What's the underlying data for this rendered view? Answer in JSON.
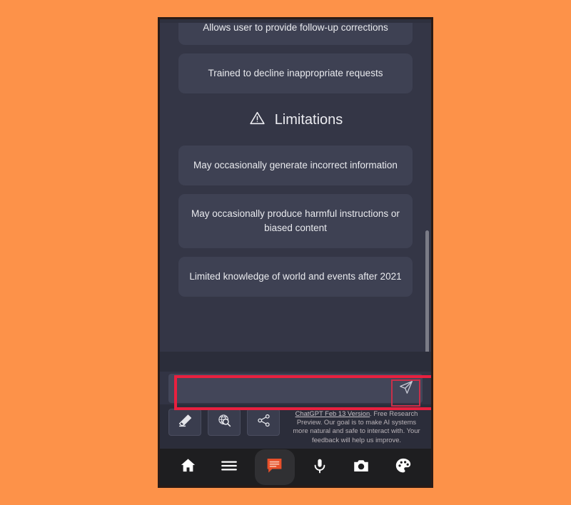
{
  "background_color": "#fd9249",
  "phone": {
    "frame_color": "#2a1b16",
    "screen_bg": "#343646"
  },
  "chat": {
    "cards_above": [
      {
        "text": "Allows user to provide follow-up corrections",
        "clipped": true
      },
      {
        "text": "Trained to decline inappropriate requests",
        "clipped": false
      }
    ],
    "section": {
      "title": "Limitations",
      "icon": "warning-triangle-icon"
    },
    "limitation_cards": [
      {
        "text": "May occasionally generate incorrect information"
      },
      {
        "text": "May occasionally produce harmful instructions or biased content"
      },
      {
        "text": "Limited knowledge of world and events after 2021"
      }
    ],
    "scrollbar_visible": true
  },
  "composer": {
    "input_value": "",
    "input_placeholder": "",
    "send_icon": "send-paper-plane-icon",
    "highlight_color": "#e8203f",
    "send_highlight_color": "#c8304a"
  },
  "tools": [
    {
      "name": "clear-conversation-button",
      "icon": "eraser-icon"
    },
    {
      "name": "web-search-button",
      "icon": "globe-search-icon"
    },
    {
      "name": "share-button",
      "icon": "share-nodes-icon"
    }
  ],
  "disclaimer": {
    "version_link": "ChatGPT Feb 13 Version",
    "body": ". Free Research Preview. Our goal is to make AI systems more natural and safe to interact with. Your feedback will help us improve."
  },
  "bottom_nav": {
    "active_color": "#e8502a",
    "items": [
      {
        "name": "nav-home",
        "icon": "home-icon",
        "active": false
      },
      {
        "name": "nav-menu",
        "icon": "hamburger-menu-icon",
        "active": false
      },
      {
        "name": "nav-chat",
        "icon": "chat-bubble-icon",
        "active": true
      },
      {
        "name": "nav-voice",
        "icon": "microphone-icon",
        "active": false
      },
      {
        "name": "nav-camera",
        "icon": "camera-icon",
        "active": false
      },
      {
        "name": "nav-theme",
        "icon": "palette-icon",
        "active": false
      }
    ]
  }
}
